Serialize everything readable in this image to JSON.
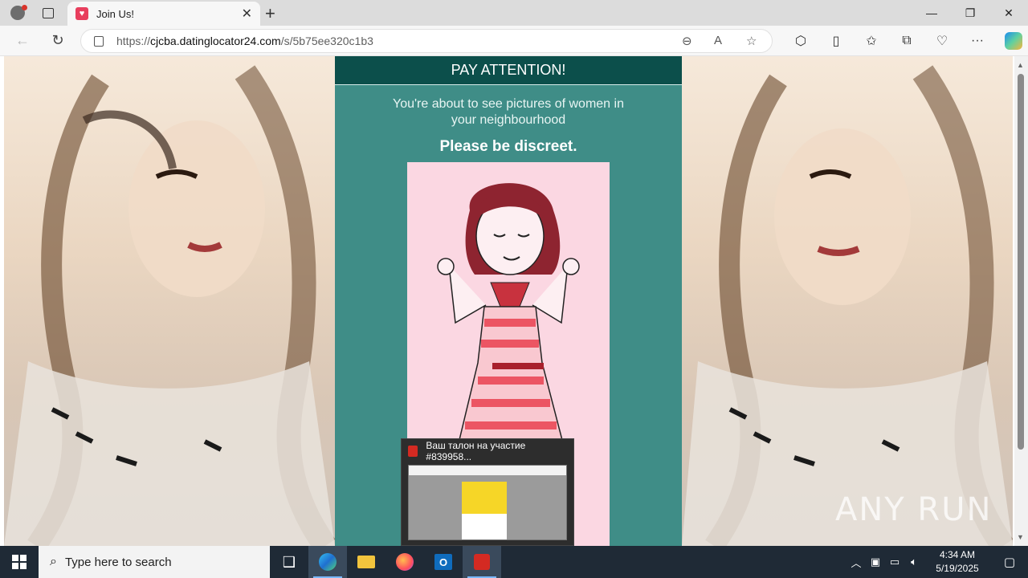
{
  "browser": {
    "tab_title": "Join Us!",
    "url_scheme": "https://",
    "url_host": "cjcba.datinglocator24.com",
    "url_path": "/s/5b75ee320c1b3",
    "icons": [
      "profile-icon",
      "tab-actions-icon",
      "close-tab-icon",
      "new-tab-icon",
      "back-icon",
      "refresh-icon",
      "lock-icon",
      "zoom-out-icon",
      "read-aloud-icon",
      "favorite-star-icon",
      "extensions-icon",
      "split-screen-icon",
      "favorites-icon",
      "collections-icon",
      "browser-essentials-icon",
      "more-icon",
      "copilot-icon"
    ]
  },
  "window": {
    "minimize": "—",
    "restore": "❐",
    "close": "✕"
  },
  "page": {
    "header": "PAY ATTENTION!",
    "message": "You're about to see pictures of women in your neighbourhood",
    "emphasis": "Please be discreet."
  },
  "popup": {
    "title": "Ваш талон на участие #839958..."
  },
  "watermark": "ANY RUN",
  "taskbar": {
    "search_placeholder": "Type here to search",
    "apps": [
      "task-view",
      "edge",
      "file-explorer",
      "firefox",
      "outlook",
      "acrobat"
    ],
    "time": "4:34 AM",
    "date": "5/19/2025"
  },
  "colors": {
    "header_bg": "#0c4f4b",
    "panel_bg": "#3f8d87",
    "illustration_bg": "#fbd7e2",
    "taskbar_bg": "#1f2a36"
  }
}
